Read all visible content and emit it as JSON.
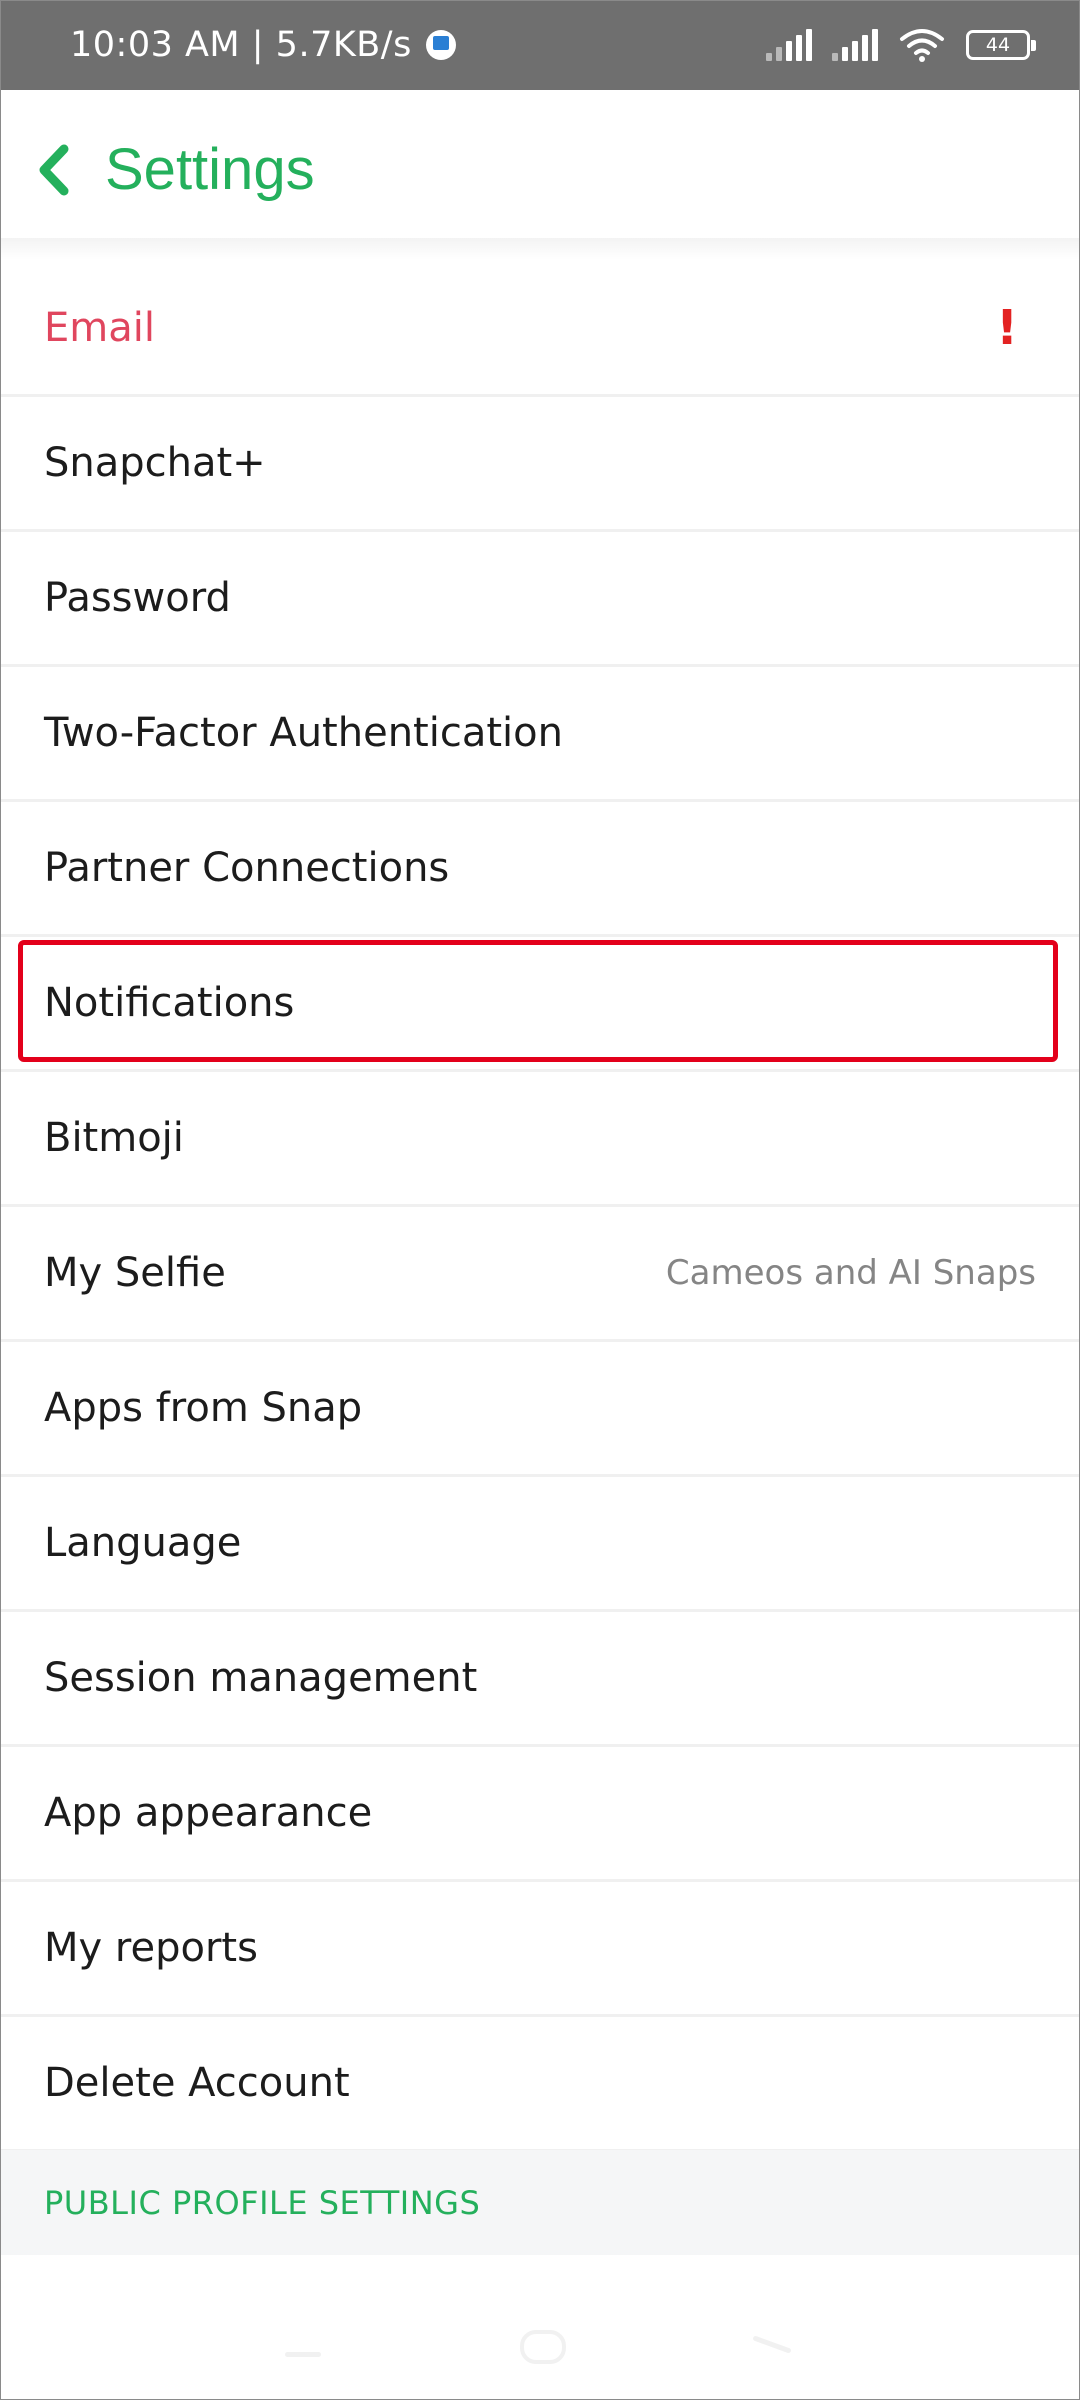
{
  "status_bar": {
    "time": "10:03 AM | 5.7KB/s",
    "battery_level": "44",
    "icons": [
      "signal-icon",
      "signal-icon",
      "wifi-icon",
      "battery-icon"
    ]
  },
  "header": {
    "title": "Settings",
    "back_icon": "chevron-left-icon"
  },
  "settings_items": [
    {
      "label": "Email",
      "alert": "!"
    },
    {
      "label": "Snapchat+"
    },
    {
      "label": "Password"
    },
    {
      "label": "Two-Factor Authentication"
    },
    {
      "label": "Partner Connections"
    },
    {
      "label": "Notifications"
    },
    {
      "label": "Bitmoji"
    },
    {
      "label": "My Selfie",
      "detail": "Cameos and AI Snaps"
    },
    {
      "label": "Apps from Snap"
    },
    {
      "label": "Language"
    },
    {
      "label": "Session management"
    },
    {
      "label": "App appearance"
    },
    {
      "label": "My reports"
    },
    {
      "label": "Delete Account"
    }
  ],
  "section_header": {
    "label": "PUBLIC PROFILE SETTINGS"
  },
  "colors": {
    "accent_green": "#24b05c",
    "alert_red": "#e32222",
    "email_pink": "#e0465e",
    "highlight_red": "#e3001b"
  }
}
